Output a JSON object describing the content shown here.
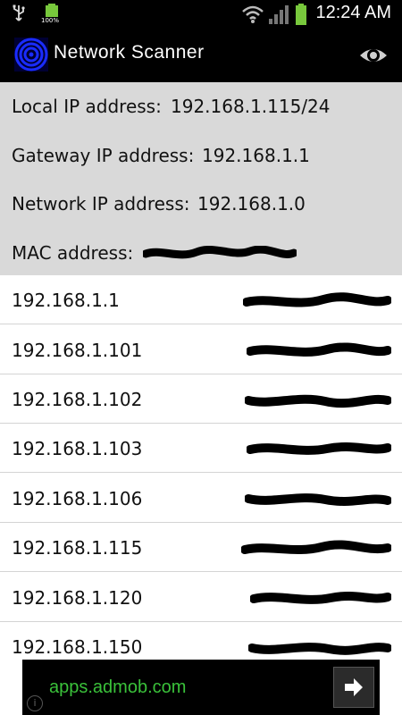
{
  "status_bar": {
    "time": "12:24 AM",
    "battery_left_pct": "100%",
    "icons": [
      "usb-icon",
      "battery-icon",
      "wifi-icon",
      "signal-icon",
      "battery-icon"
    ]
  },
  "action_bar": {
    "title": "Network Scanner",
    "icon": "radar-icon",
    "action_icon": "eye-icon"
  },
  "info": {
    "local_ip_label": "Local IP address:",
    "local_ip_value": "192.168.1.115/24",
    "gateway_label": "Gateway IP address:",
    "gateway_value": "192.168.1.1",
    "network_label": "Network IP address:",
    "network_value": "192.168.1.0",
    "mac_label": "MAC address:"
  },
  "hosts": [
    {
      "ip": "192.168.1.1"
    },
    {
      "ip": "192.168.1.101"
    },
    {
      "ip": "192.168.1.102"
    },
    {
      "ip": "192.168.1.103"
    },
    {
      "ip": "192.168.1.106"
    },
    {
      "ip": "192.168.1.115"
    },
    {
      "ip": "192.168.1.120"
    },
    {
      "ip": "192.168.1.150"
    }
  ],
  "ad": {
    "text": "apps.admob.com",
    "arrow_icon": "arrow-right-icon",
    "info_icon": "info-icon",
    "info_glyph": "i"
  },
  "colors": {
    "info_background": "#d9d9d9",
    "ad_text": "#3ac13a",
    "battery_green": "#78c83c"
  }
}
